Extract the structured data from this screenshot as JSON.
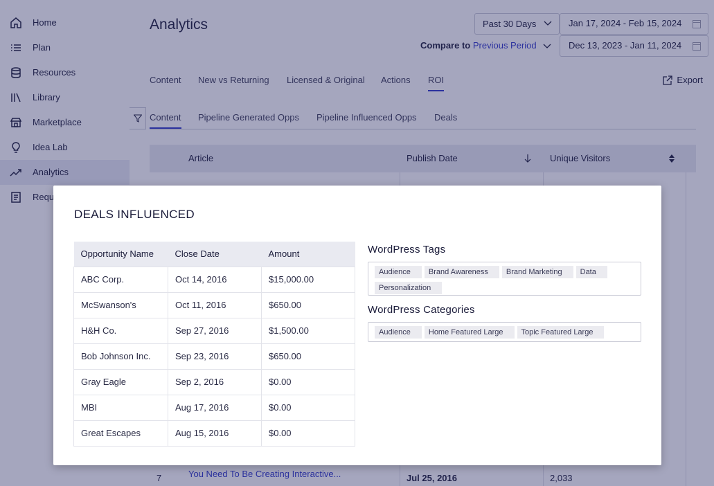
{
  "sidebar": {
    "items": [
      {
        "label": "Home",
        "icon": "home-icon"
      },
      {
        "label": "Plan",
        "icon": "list-icon"
      },
      {
        "label": "Resources",
        "icon": "database-icon"
      },
      {
        "label": "Library",
        "icon": "library-icon"
      },
      {
        "label": "Marketplace",
        "icon": "store-icon"
      },
      {
        "label": "Idea Lab",
        "icon": "lightbulb-icon"
      },
      {
        "label": "Analytics",
        "icon": "trend-icon"
      },
      {
        "label": "Requ",
        "icon": "document-icon"
      }
    ]
  },
  "header": {
    "title": "Analytics",
    "period": "Past 30 Days",
    "date_range": "Jan 17, 2024 - Feb 15, 2024",
    "compare_label": "Compare to",
    "compare_value": "Previous Period",
    "compare_range": "Dec 13, 2023 - Jan 11, 2024"
  },
  "tabs": [
    {
      "label": "Content"
    },
    {
      "label": "New vs Returning"
    },
    {
      "label": "Licensed & Original"
    },
    {
      "label": "Actions"
    },
    {
      "label": "ROI"
    }
  ],
  "export_label": "Export",
  "subtabs": [
    {
      "label": "Content"
    },
    {
      "label": "Pipeline Generated Opps"
    },
    {
      "label": "Pipeline Influenced Opps"
    },
    {
      "label": "Deals"
    }
  ],
  "background_table": {
    "headers": {
      "article": "Article",
      "publish_date": "Publish Date",
      "unique_visitors": "Unique Visitors"
    },
    "visible_row": {
      "index": "7",
      "article": "You Need To Be Creating Interactive...",
      "date": "Jul 25, 2016",
      "visitors": "2,033"
    }
  },
  "modal": {
    "title": "DEALS INFLUENCED",
    "table": {
      "headers": [
        "Opportunity Name",
        "Close Date",
        "Amount"
      ],
      "rows": [
        [
          "ABC Corp.",
          "Oct 14, 2016",
          "$15,000.00"
        ],
        [
          "McSwanson's",
          "Oct 11, 2016",
          "$650.00"
        ],
        [
          "H&H Co.",
          "Sep 27, 2016",
          "$1,500.00"
        ],
        [
          "Bob Johnson Inc.",
          "Sep 23, 2016",
          "$650.00"
        ],
        [
          "Gray Eagle",
          "Sep 2, 2016",
          "$0.00"
        ],
        [
          "MBI",
          "Aug 17, 2016",
          "$0.00"
        ],
        [
          "Great Escapes",
          "Aug 15, 2016",
          "$0.00"
        ]
      ]
    },
    "wp_tags_label": "WordPress Tags",
    "wp_tags": [
      "Audience",
      "Brand Awareness",
      "Brand Marketing",
      "Data",
      "Personalization"
    ],
    "wp_categories_label": "WordPress Categories",
    "wp_categories": [
      "Audience",
      "Home Featured Large",
      "Topic Featured Large"
    ]
  },
  "colors": {
    "accent": "#2d36c9",
    "overlay": "#282c64",
    "header_bg": "#e9eaf1"
  }
}
